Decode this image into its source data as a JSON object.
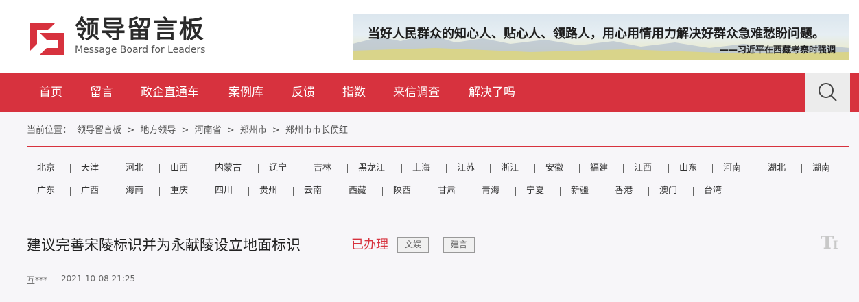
{
  "header": {
    "logo_cn": "领导留言板",
    "logo_en": "Message Board for Leaders",
    "banner_quote": "当好人民群众的知心人、贴心人、领路人，用心用情用力解决好群众急难愁盼问题。",
    "banner_author": "——习近平在西藏考察时强调"
  },
  "nav": {
    "items": [
      "首页",
      "留言",
      "政企直通车",
      "案例库",
      "反馈",
      "指数",
      "来信调查",
      "解决了吗"
    ],
    "search_icon": "search-icon"
  },
  "breadcrumb": {
    "prefix": "当前位置：",
    "items": [
      "领导留言板",
      "地方领导",
      "河南省",
      "郑州市",
      "郑州市市长侯红"
    ],
    "sep": ">"
  },
  "regions": {
    "row1": [
      "北京",
      "天津",
      "河北",
      "山西",
      "内蒙古",
      "辽宁",
      "吉林",
      "黑龙江",
      "上海",
      "江苏",
      "浙江",
      "安徽",
      "福建",
      "江西",
      "山东",
      "河南",
      "湖北",
      "湖南"
    ],
    "row2": [
      "广东",
      "广西",
      "海南",
      "重庆",
      "四川",
      "贵州",
      "云南",
      "西藏",
      "陕西",
      "甘肃",
      "青海",
      "宁夏",
      "新疆",
      "香港",
      "澳门",
      "台湾"
    ]
  },
  "message": {
    "title": "建议完善宋陵标识并为永献陵设立地面标识",
    "status": "已办理",
    "tags": [
      "文娱",
      "建言"
    ],
    "author": "互***",
    "date": "2021-10-08 21:25",
    "font_toggle_icon": "font-size-icon"
  },
  "colors": {
    "accent": "#d7323e",
    "background": "#f7f6f9"
  }
}
